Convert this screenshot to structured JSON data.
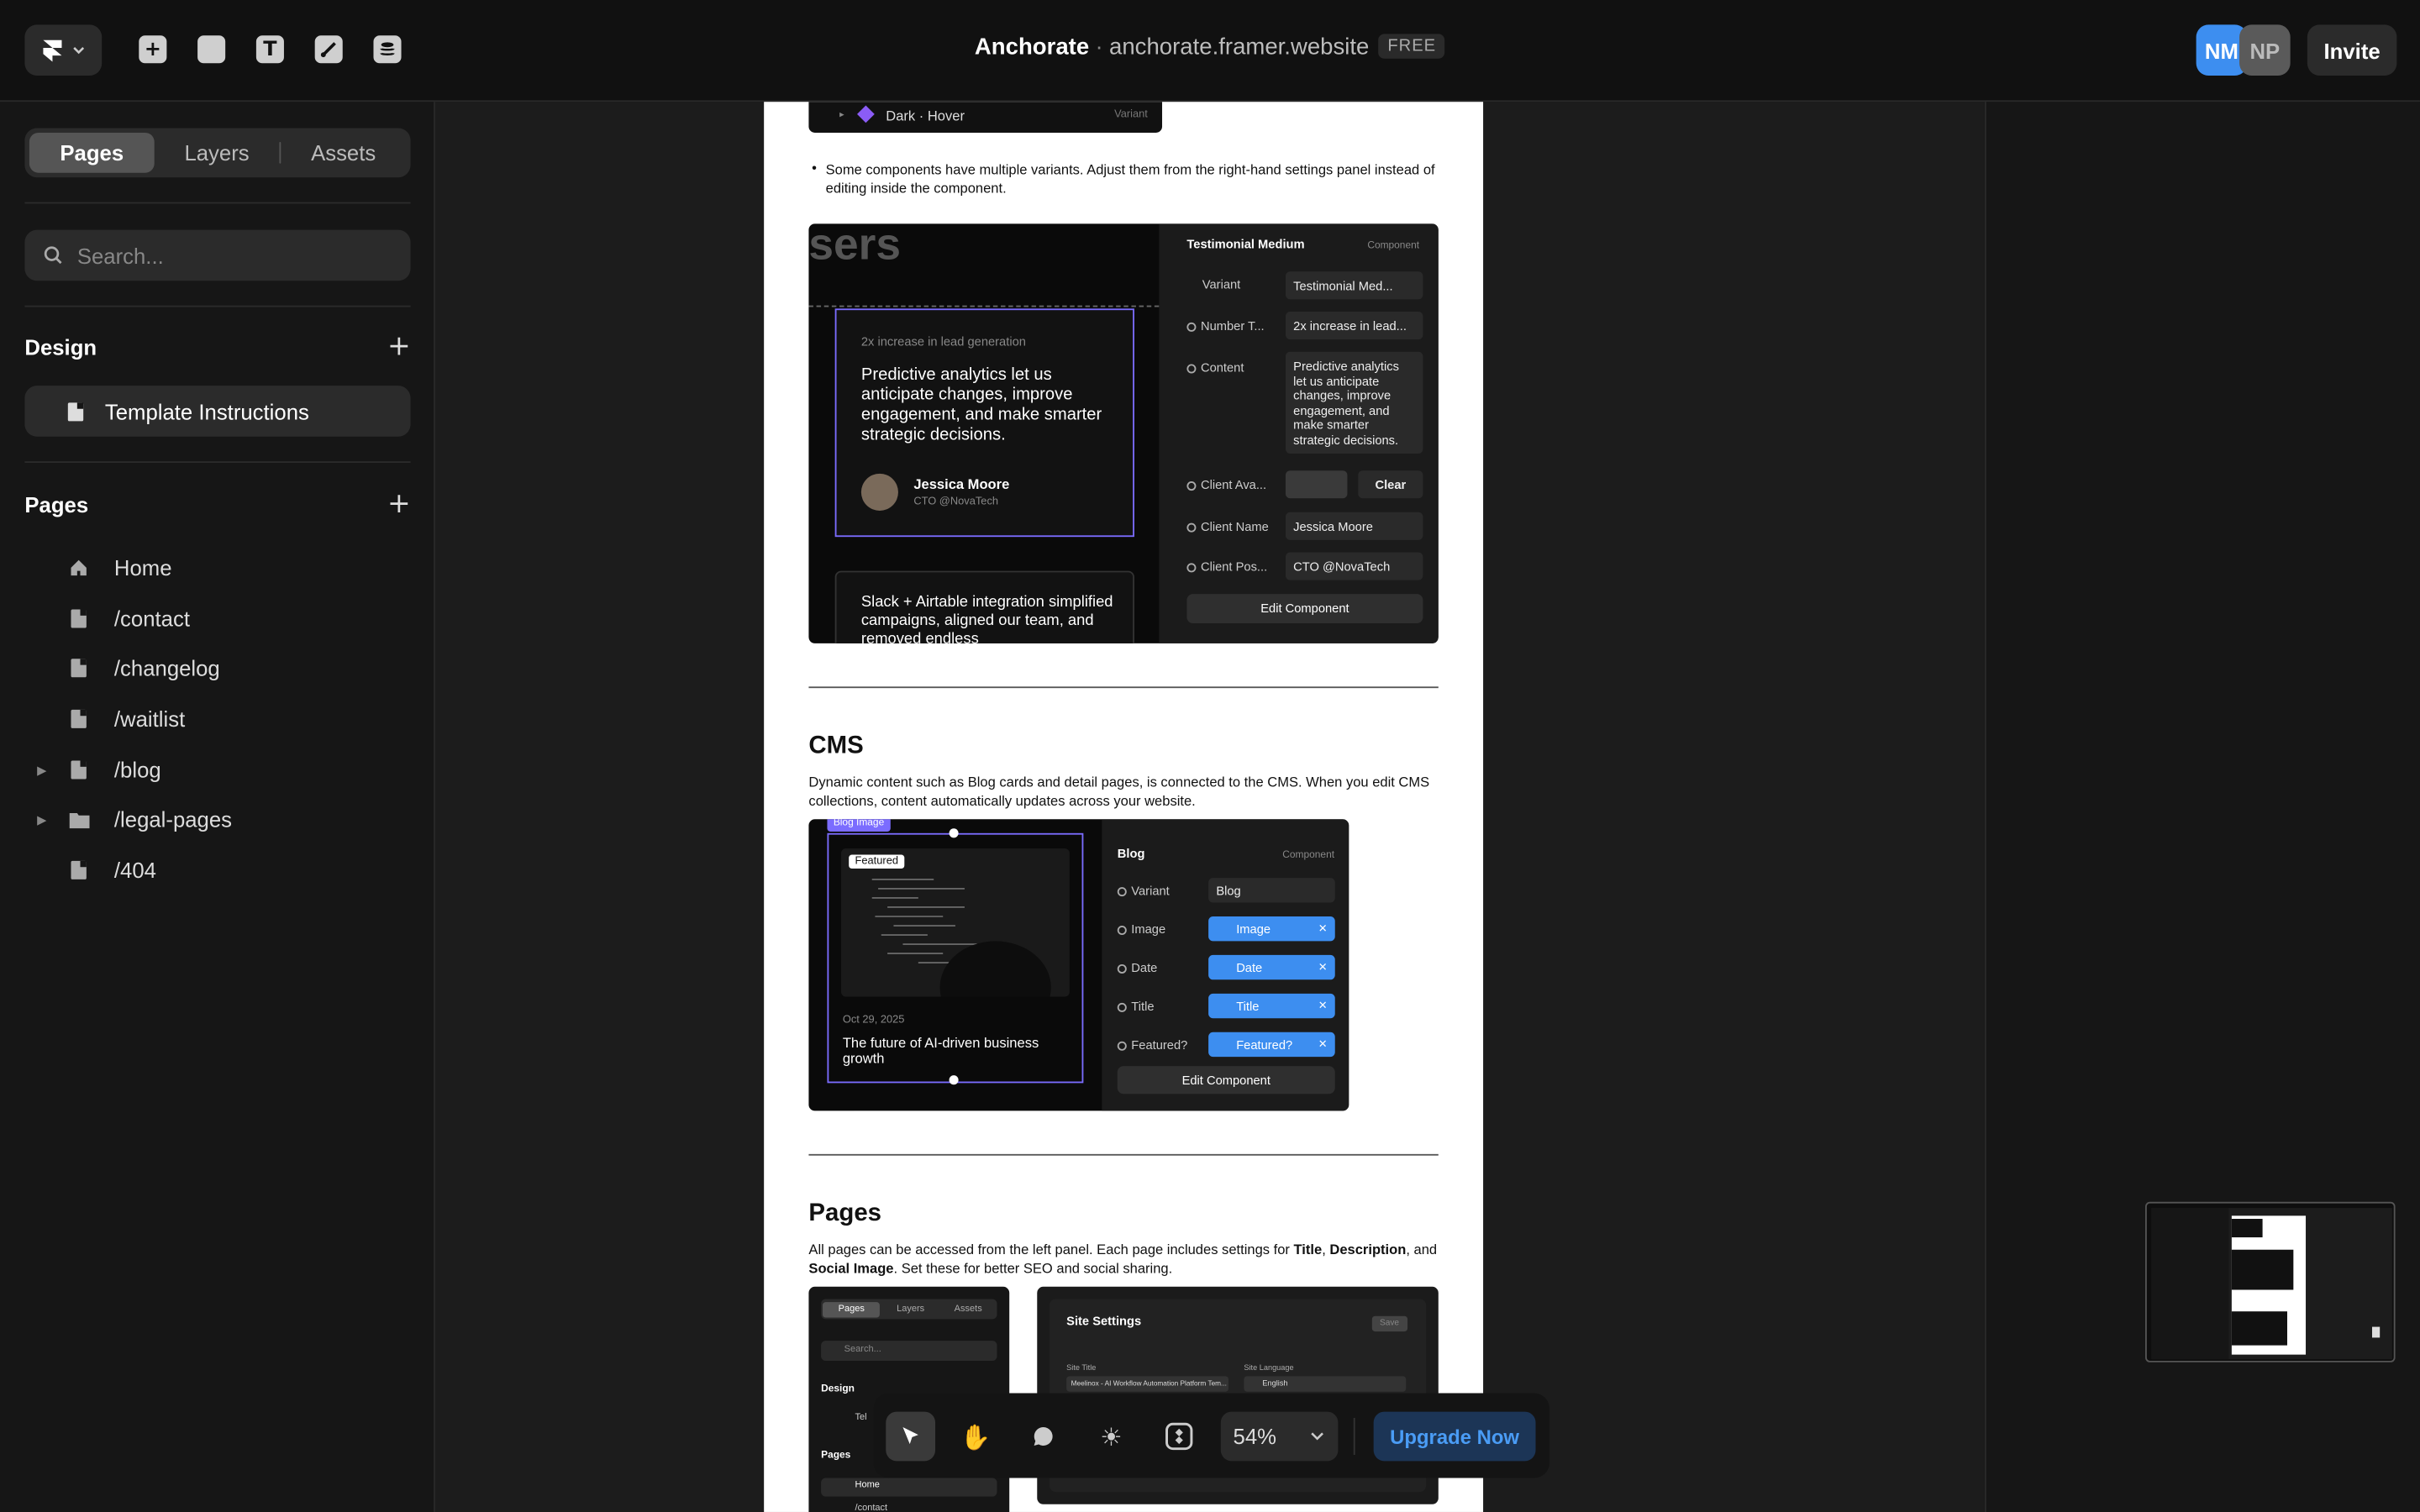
{
  "topbar": {
    "project_name": "Anchorate",
    "separator": "·",
    "domain": "anchorate.framer.website",
    "plan_badge": "FREE",
    "avatars": [
      {
        "initials": "NM",
        "color": "#3d8ef0"
      },
      {
        "initials": "NP",
        "color": "#5a5a5a"
      }
    ],
    "invite_label": "Invite"
  },
  "sidebar": {
    "tabs": [
      "Pages",
      "Layers",
      "Assets"
    ],
    "active_tab": "Pages",
    "search_placeholder": "Search...",
    "design": {
      "title": "Design",
      "items": [
        "Template Instructions"
      ]
    },
    "pages": {
      "title": "Pages",
      "items": [
        {
          "label": "Home",
          "icon": "home-icon",
          "expandable": false
        },
        {
          "label": "/contact",
          "icon": "file-icon",
          "expandable": false
        },
        {
          "label": "/changelog",
          "icon": "file-icon",
          "expandable": false
        },
        {
          "label": "/waitlist",
          "icon": "file-icon",
          "expandable": false
        },
        {
          "label": "/blog",
          "icon": "file-icon",
          "expandable": true
        },
        {
          "label": "/legal-pages",
          "icon": "folder-icon",
          "expandable": true
        },
        {
          "label": "/404",
          "icon": "file-icon",
          "expandable": false
        }
      ]
    }
  },
  "doc": {
    "variant_row": {
      "label": "Dark · Hover",
      "tag": "Variant"
    },
    "variants_note": "Some components have multiple variants. Adjust them from the right-hand settings panel instead of editing inside the component.",
    "testimonial_shot": {
      "bg_heading": "sers",
      "card_kicker": "2x increase in lead generation",
      "card_quote": "Predictive analytics let us anticipate changes, improve engagement, and make smarter strategic decisions.",
      "person_name": "Jessica Moore",
      "person_role": "CTO @NovaTech",
      "card2_text": "Slack + Airtable integration simplified campaigns, aligned our team, and removed endless",
      "panel_title": "Testimonial Medium",
      "panel_tag": "Component",
      "rows": [
        {
          "label": "Variant",
          "value": "Testimonial Med..."
        },
        {
          "label": "Number T...",
          "value": "2x increase in lead..."
        },
        {
          "label": "Content",
          "value": "Predictive analytics let us anticipate changes, improve engagement, and make smarter strategic decisions."
        },
        {
          "label": "Client Ava...",
          "value": "Clear"
        },
        {
          "label": "Client Name",
          "value": "Jessica Moore"
        },
        {
          "label": "Client Pos...",
          "value": "CTO @NovaTech"
        }
      ],
      "edit_label": "Edit Component"
    },
    "cms": {
      "heading": "CMS",
      "text": "Dynamic content such as Blog cards and detail pages, is connected to the CMS. When you edit CMS collections, content automatically updates across your website.",
      "shot": {
        "selection_tag": "Blog Image",
        "featured_badge": "Featured",
        "date": "Oct 29, 2025",
        "title": "The future of AI-driven business growth",
        "panel_title": "Blog",
        "panel_tag": "Component",
        "rows": [
          {
            "label": "Variant",
            "value": "Blog"
          },
          {
            "label": "Image",
            "value": "Image"
          },
          {
            "label": "Date",
            "value": "Date"
          },
          {
            "label": "Title",
            "value": "Title"
          },
          {
            "label": "Featured?",
            "value": "Featured?"
          }
        ],
        "edit_label": "Edit Component"
      }
    },
    "pages_section": {
      "heading": "Pages",
      "text_parts": [
        "All pages can be accessed from the left panel. Each page includes settings for ",
        "Title",
        ", ",
        "Description",
        ", and ",
        "Social Image",
        ". Set these for better SEO and social sharing."
      ],
      "mini_sidebar": {
        "tabs": [
          "Pages",
          "Layers",
          "Assets"
        ],
        "search": "Search...",
        "design_title": "Design",
        "design_item": "Tel",
        "pages_title": "Pages",
        "items": [
          "Home",
          "/contact"
        ]
      },
      "site_settings": {
        "title": "Site Settings",
        "save": "Save",
        "site_title_label": "Site Title",
        "site_title_value": "Meelinox - AI Workflow Automation Platform Tem...",
        "language_label": "Site Language",
        "language_value": "English"
      }
    }
  },
  "bottom_toolbar": {
    "zoom": "54%",
    "upgrade_label": "Upgrade Now"
  }
}
